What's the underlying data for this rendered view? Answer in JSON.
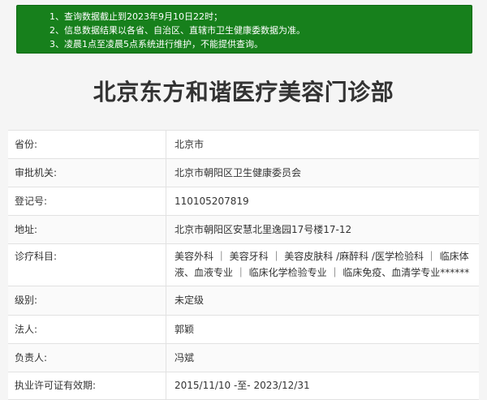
{
  "notice": {
    "lines": [
      "1、查询数据截止到2023年9月10日22时；",
      "2、信息数据结果以各省、自治区、直辖市卫生健康委数据为准。",
      "3、凌晨1点至凌晨5点系统进行维护，不能提供查询。"
    ]
  },
  "title": "北京东方和谐医疗美容门诊部",
  "rows": [
    {
      "label": "省份:",
      "value": "北京市"
    },
    {
      "label": "审批机关:",
      "value": "北京市朝阳区卫生健康委员会"
    },
    {
      "label": "登记号:",
      "value": "110105207819"
    },
    {
      "label": "地址:",
      "value": "北京市朝阳区安慧北里逸园17号楼17-12"
    },
    {
      "label": "诊疗科目:",
      "value": "美容外科 ｜ 美容牙科 ｜ 美容皮肤科 /麻醉科 /医学检验科 ｜ 临床体液、血液专业 ｜ 临床化学检验专业 ｜ 临床免疫、血清学专业******"
    },
    {
      "label": "级别:",
      "value": "未定级"
    },
    {
      "label": "法人:",
      "value": "郭颖"
    },
    {
      "label": "负责人:",
      "value": "冯斌"
    },
    {
      "label": "执业许可证有效期:",
      "value": "2015/11/10 -至- 2023/12/31"
    }
  ],
  "colors": {
    "notice_bg": "#17801c",
    "page_bg": "#f5f5f5",
    "border": "#e2e2e2"
  }
}
